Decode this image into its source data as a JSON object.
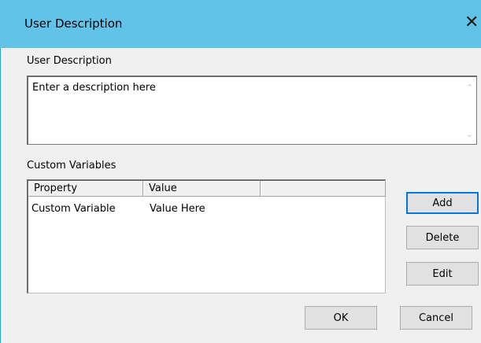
{
  "window": {
    "title": "User Description",
    "close_glyph": "✕"
  },
  "description": {
    "label": "User Description",
    "value": "Enter a description here",
    "scroll_up_glyph": "⌃",
    "scroll_down_glyph": "⌄"
  },
  "custom_variables": {
    "label": "Custom Variables",
    "columns": [
      "Property",
      "Value",
      ""
    ],
    "rows": [
      {
        "property": "Custom Variable",
        "value": "Value Here"
      }
    ]
  },
  "buttons": {
    "add": "Add",
    "delete": "Delete",
    "edit": "Edit",
    "ok": "OK",
    "cancel": "Cancel"
  },
  "colors": {
    "titlebar": "#62c3e9",
    "dialog_bg": "#f0f0f0",
    "button_bg": "#e1e1e1"
  }
}
